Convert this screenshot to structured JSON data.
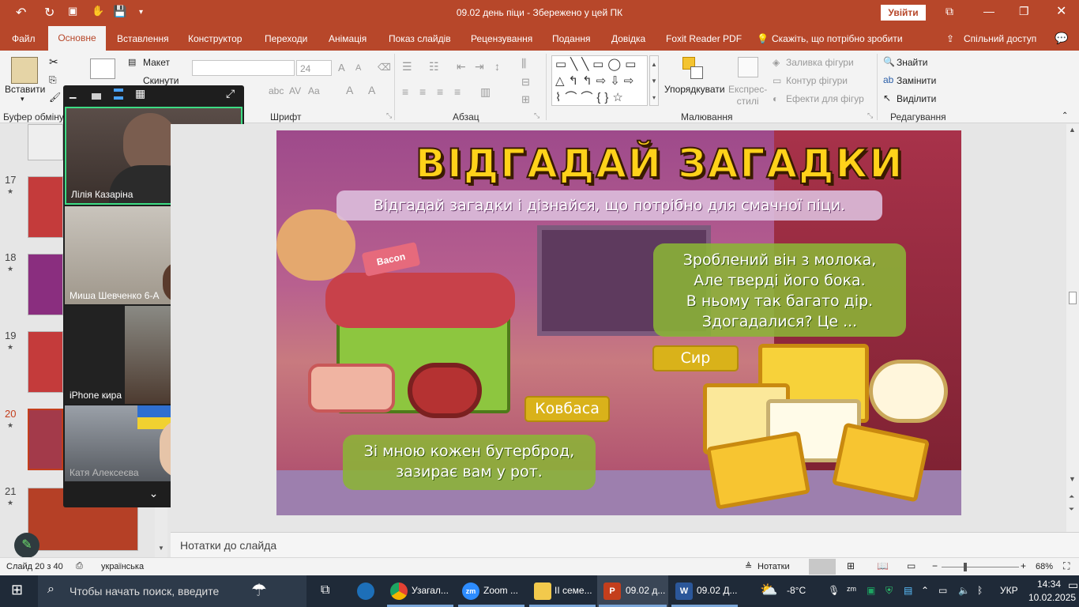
{
  "titlebar": {
    "document_title": "09.02 день піци  -  Збережено у цей ПК",
    "signin_label": "Увійти",
    "save_icon": "save-icon",
    "undo_icon": "undo-icon"
  },
  "tabs": [
    "Файл",
    "Основне",
    "Вставлення",
    "Конструктор",
    "Переходи",
    "Анімація",
    "Показ слайдів",
    "Рецензування",
    "Подання",
    "Довідка",
    "Foxit Reader PDF"
  ],
  "tell_me": "Скажіть, що потрібно зробити",
  "share_label": "Спільний доступ",
  "ribbon": {
    "paste_label": "Вставити",
    "layout_label": "Макет",
    "reset_label": "Скинути",
    "font_size": "24",
    "arrange_label": "Упорядкувати",
    "quick_styles_label": "Експрес-\nстилі",
    "shape_fill": "Заливка фігури",
    "shape_outline": "Контур фігури",
    "shape_effects": "Ефекти для фігур",
    "find_label": "Знайти",
    "replace_label": "Замінити",
    "select_label": "Виділити",
    "groups": {
      "clipboard": "Буфер обміну",
      "font": "Шрифт",
      "paragraph": "Абзац",
      "drawing": "Малювання",
      "editing": "Редагування"
    }
  },
  "slides": [
    {
      "num": "17"
    },
    {
      "num": "18"
    },
    {
      "num": "19"
    },
    {
      "num": "20"
    },
    {
      "num": "21"
    }
  ],
  "zoom": {
    "participants": [
      "Лілія Казаріна",
      "Миша Шевченко 6-А",
      "iPhone кира",
      "Катя Алексеєва"
    ]
  },
  "slide": {
    "title": "ВІДГАДАЙ ЗАГАДКИ",
    "subtitle": "Відгадай загадки і дізнайся, що потрібно для смачної піци.",
    "riddle1": [
      "Зроблений він з молока,",
      "Але тверді його бока.",
      "В ньому так багато дір.",
      "Здогадалися? Це ..."
    ],
    "answer1": "Сир",
    "answer2": "Ковбаса",
    "riddle2": [
      "Зі мною кожен бутерброд,",
      "зазирає вам у рот."
    ],
    "bacon_label": "Bacon"
  },
  "notes_placeholder": "Нотатки до слайда",
  "status": {
    "slide_info": "Слайд 20 з 40",
    "language": "українська",
    "notes_btn": "Нотатки",
    "zoom": "68%"
  },
  "taskbar": {
    "search_placeholder": "Чтобы начать поиск, введите",
    "apps": [
      "Узагал...",
      "Zoom ...",
      "II семе...",
      "09.02 д...",
      "09.02 Д..."
    ],
    "weather": "-8°C",
    "lang": "УКР",
    "time": "14:34",
    "date": "10.02.2025"
  }
}
